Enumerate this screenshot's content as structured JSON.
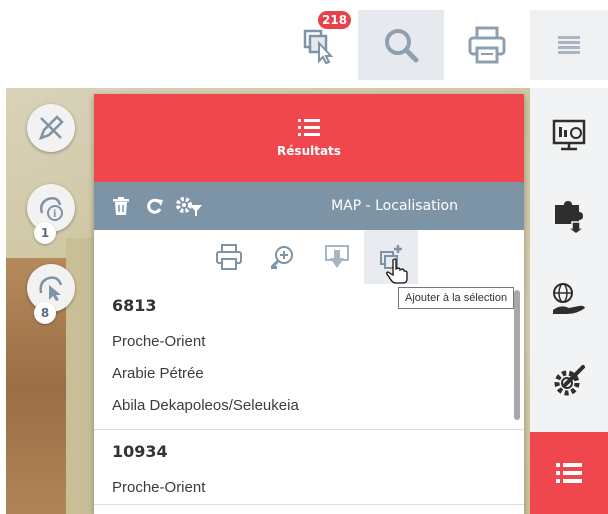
{
  "top_bar": {
    "selection_count": "218",
    "icons": [
      "selection-cursor-icon",
      "search-icon",
      "printer-icon",
      "hamburger-menu-icon"
    ]
  },
  "map_tools": {
    "info_count": "1",
    "select_count": "8",
    "icons": [
      "draw-pencil-icon",
      "info-query-icon",
      "select-pointer-icon"
    ]
  },
  "right_bar": {
    "icons": [
      "monitor-dashboard-icon",
      "puzzle-download-icon",
      "globe-hand-icon",
      "gear-wrench-icon",
      "list-results-icon"
    ],
    "active_color": "#ef474d"
  },
  "panel": {
    "header_title": "Résultats",
    "layer_name": "MAP - Localisation",
    "toolbar_icons": [
      "trash-icon",
      "refresh-icon",
      "gear-filter-icon"
    ],
    "action_icons": [
      "print-icon",
      "zoom-to-icon",
      "export-down-icon",
      "add-to-selection-icon"
    ],
    "results": [
      {
        "id": "6813",
        "lines": [
          "Proche-Orient",
          "Arabie Pétrée",
          "Abila Dekapoleos/Seleukeia"
        ]
      },
      {
        "id": "10934",
        "lines": [
          "Proche-Orient"
        ]
      }
    ]
  },
  "tooltip": {
    "text": "Ajouter à la sélection"
  },
  "colors": {
    "accent_red": "#ef474d",
    "toolbar_slate": "#7d93a6",
    "badge_red": "#e8414a"
  }
}
